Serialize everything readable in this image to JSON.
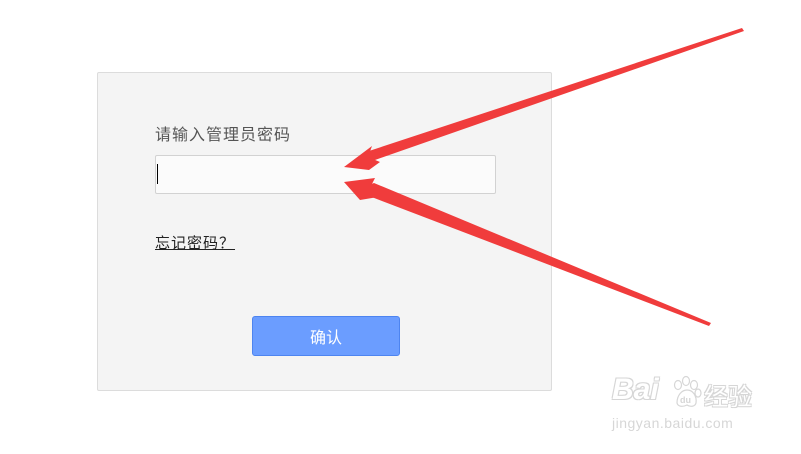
{
  "login": {
    "prompt": "请输入管理员密码",
    "password_value": "",
    "forgot_link": "忘记密码？",
    "confirm_button": "确认"
  },
  "annotation": {
    "arrow_color": "#f03c3c",
    "arrow_count": 2
  },
  "watermark": {
    "brand_text": "Baidu",
    "suffix_text": "经验",
    "url": "jingyan.baidu.com"
  },
  "colors": {
    "panel_background": "#f4f4f4",
    "button_background": "#6b9dff",
    "button_text": "#ffffff"
  }
}
